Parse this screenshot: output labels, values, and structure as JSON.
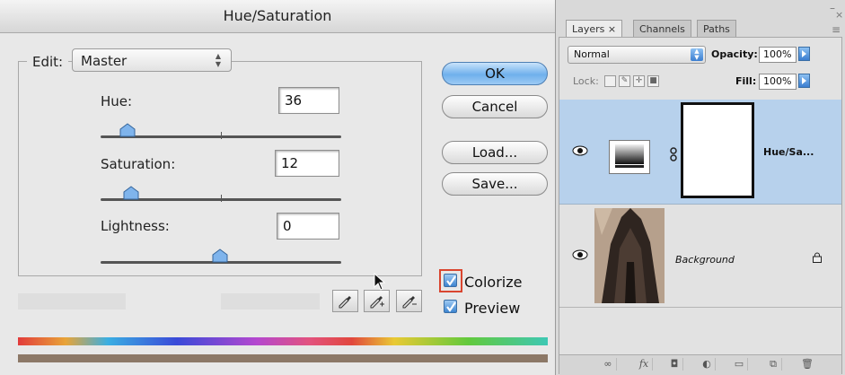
{
  "dialog": {
    "title": "Hue/Saturation",
    "edit_label": "Edit:",
    "edit_value": "Master",
    "hue": {
      "label": "Hue:",
      "value": "36"
    },
    "saturation": {
      "label": "Saturation:",
      "value": "12"
    },
    "lightness": {
      "label": "Lightness:",
      "value": "0"
    },
    "buttons": {
      "ok": "OK",
      "cancel": "Cancel",
      "load": "Load...",
      "save": "Save..."
    },
    "colorize": {
      "label": "Colorize",
      "checked": true
    },
    "preview": {
      "label": "Preview",
      "checked": true
    },
    "icons": [
      "eyedropper-icon",
      "eyedropper-plus-icon",
      "eyedropper-minus-icon"
    ]
  },
  "layers_panel": {
    "tabs": [
      {
        "label": "Layers ×",
        "active": true
      },
      {
        "label": "Channels",
        "active": false
      },
      {
        "label": "Paths",
        "active": false
      }
    ],
    "blend_mode": "Normal",
    "opacity_label": "Opacity:",
    "opacity_value": "100%",
    "lock_label": "Lock:",
    "fill_label": "Fill:",
    "fill_value": "100%",
    "layers": [
      {
        "name": "Hue/Sa...",
        "type": "adjustment",
        "selected": true,
        "visible": true
      },
      {
        "name": "Background",
        "type": "image",
        "selected": false,
        "visible": true,
        "locked": true
      }
    ],
    "footer_icons": [
      "link-icon",
      "fx-icon",
      "mask-icon",
      "adjustment-icon",
      "group-folder-icon",
      "new-layer-icon",
      "trash-icon"
    ]
  },
  "colors": {
    "selected_row": "#b7d1ec",
    "default_button": "#6fb0ec",
    "colorize_highlight": "#d9452f",
    "checkbox": "#3d85d0"
  }
}
